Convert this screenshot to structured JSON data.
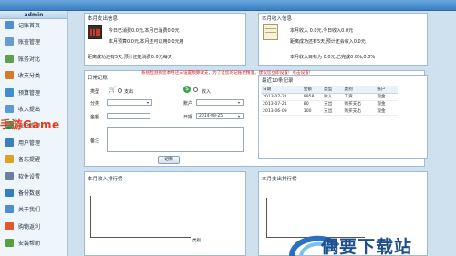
{
  "sidebar": {
    "title": "admin",
    "items": [
      {
        "label": "记账首页",
        "icon": "home-icon",
        "color": "#4a8fd8"
      },
      {
        "label": "账查管理",
        "icon": "ledger-icon",
        "color": "#6a9ad0"
      },
      {
        "label": "账务对比",
        "icon": "compare-icon",
        "color": "#5fa14a"
      },
      {
        "label": "收支分类",
        "icon": "category-icon",
        "color": "#d77a2a"
      },
      {
        "label": "预算管理",
        "icon": "budget-icon",
        "color": "#3f8fd0"
      },
      {
        "label": "收入提出",
        "icon": "income-icon",
        "color": "#5b9bd5"
      },
      {
        "label": "账户管理",
        "icon": "account-icon",
        "color": "#2c8a4a"
      },
      {
        "label": "用户管理",
        "icon": "user-icon",
        "color": "#3a7dc0"
      },
      {
        "label": "备忘提醒",
        "icon": "memo-icon",
        "color": "#e0a020"
      },
      {
        "label": "软件设置",
        "icon": "settings-icon",
        "color": "#6b7fa0"
      },
      {
        "label": "备份数据",
        "icon": "backup-icon",
        "color": "#2f80c8"
      },
      {
        "label": "关于我们",
        "icon": "about-icon",
        "color": "#4a90d0"
      },
      {
        "label": "购物返利",
        "icon": "cart-icon",
        "color": "#e05a2a"
      },
      {
        "label": "安装帮助",
        "icon": "help-icon",
        "color": "#5aa03a"
      }
    ]
  },
  "expense_info": {
    "title": "本月支出信息",
    "lines": [
      "今日已消费0.0元,本月已消费0.0元",
      "本月预算0.0元,本月还可以用0.0元用",
      "距离成功还有5天,预计还能消费0.0元每天"
    ]
  },
  "income_info": {
    "title": "本月收入信息",
    "lines": [
      "本月收入 0.0元,今日收入0.0元",
      "距离成功还有5天,预计还会收入0.0元",
      "本月收入目标为 0.0元,已完成0.0%,0.0%"
    ]
  },
  "daily_record": {
    "title": "日常记账",
    "notice": "系统检测到您本月还未设置预算收支，为了让您的记账更精准，建议您立即设置！点击设置!",
    "type_label": "类型",
    "expense_option": "支出",
    "income_option": "收入",
    "category_label": "分类",
    "account_label": "账户",
    "amount_label": "金额",
    "date_label": "日期",
    "date_value": "2014-08-25",
    "note_label": "备注",
    "submit_label": "记账"
  },
  "recent": {
    "title": "最近10条记录",
    "columns": [
      "日期",
      "金额",
      "类型",
      "类别",
      "账户"
    ],
    "rows": [
      [
        "2013-07-21",
        "9958",
        "收入",
        "工资",
        "现金"
      ],
      [
        "2013-07-21",
        "80",
        "支出",
        "购买支出",
        "现金"
      ],
      [
        "2013-06-09",
        "100",
        "支出",
        "购买支出",
        "现金"
      ]
    ]
  },
  "charts": {
    "income_title": "本月收入排行榜",
    "expense_title": "本月支出排行榜",
    "income_axis_label": "类别"
  },
  "watermarks": {
    "left": "手游Game",
    "right": "偶要下载站"
  }
}
